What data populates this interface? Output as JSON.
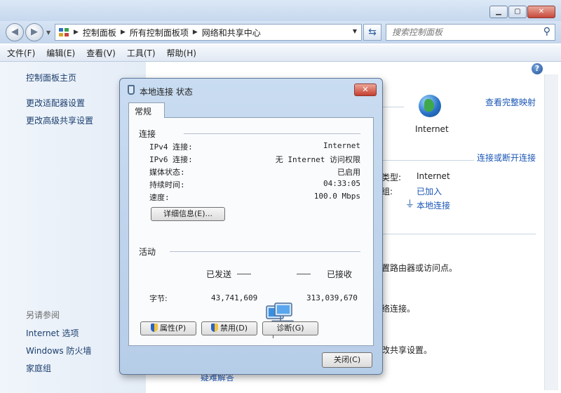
{
  "window": {
    "controls": {
      "minimize": "▁",
      "maximize": "▢",
      "close": "✕"
    }
  },
  "nav": {
    "back": "◀",
    "forward": "▶",
    "dropdown": "▼"
  },
  "breadcrumb": {
    "items": [
      "控制面板",
      "所有控制面板项",
      "网络和共享中心"
    ]
  },
  "search": {
    "placeholder": "搜索控制面板"
  },
  "menu": {
    "items": [
      "文件(F)",
      "编辑(E)",
      "查看(V)",
      "工具(T)",
      "帮助(H)"
    ]
  },
  "sidebar": {
    "home": "控制面板主页",
    "links": [
      "更改适配器设置",
      "更改高级共享设置"
    ],
    "see_also_label": "另请参阅",
    "see_also": [
      "Internet 选项",
      "Windows 防火墙",
      "家庭组"
    ]
  },
  "main": {
    "help": "?",
    "view_full_map": "查看完整映射",
    "internet_label": "Internet",
    "connect_disconnect": "连接或断开连接",
    "type_label": "类型:",
    "type_value": "Internet",
    "homegroup_label": "组:",
    "homegroup_value": "已加入",
    "connection_link": "本地连接",
    "text_router": "置路由器或访问点。",
    "text_network": "络连接。",
    "text_sharing": "改共享设置。",
    "text_bottom": "疑难解答"
  },
  "dialog": {
    "title": "本地连接 状态",
    "close_glyph": "✕",
    "tab": "常规",
    "connection_group": "连接",
    "rows": [
      {
        "label": "IPv4 连接:",
        "value": "Internet"
      },
      {
        "label": "IPv6 连接:",
        "value": "无 Internet 访问权限"
      },
      {
        "label": "媒体状态:",
        "value": "已启用"
      },
      {
        "label": "持续时间:",
        "value": "04:33:05"
      },
      {
        "label": "速度:",
        "value": "100.0 Mbps"
      }
    ],
    "details_button": "详细信息(E)...",
    "activity_group": "活动",
    "sent_label": "已发送",
    "received_label": "已接收",
    "bytes_label": "字节:",
    "bytes_sent": "43,741,609",
    "bytes_received": "313,039,670",
    "properties_button": "属性(P)",
    "disable_button": "禁用(D)",
    "diagnose_button": "诊断(G)",
    "close_button": "关闭(C)"
  }
}
